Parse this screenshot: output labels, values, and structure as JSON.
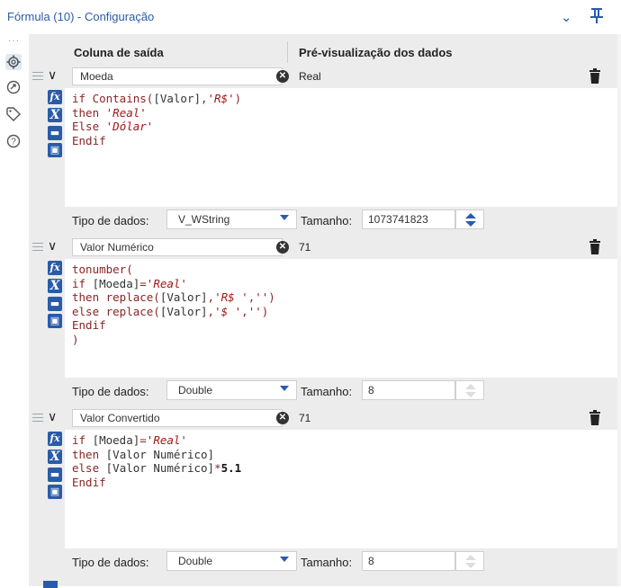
{
  "window": {
    "title": "Fórmula (10) - Configuração"
  },
  "icons": {
    "collapse": "chevron-down-icon",
    "pin": "pin-icon"
  },
  "rail": {
    "dots": "···",
    "items": [
      "settings-icon",
      "navigate-icon",
      "tag-icon",
      "help-icon"
    ]
  },
  "header": {
    "output_column": "Coluna de saída",
    "preview": "Pré-visualização dos dados"
  },
  "formulas": [
    {
      "name": "Moeda",
      "preview": "Real",
      "code_lines": [
        "if Contains([Valor],'R$')",
        "then 'Real'",
        "Else 'Dólar'",
        "Endif"
      ],
      "type_label": "Tipo de dados:",
      "type": "V_WString",
      "size_label": "Tamanho:",
      "size": "1073741823"
    },
    {
      "name": "Valor Numérico",
      "preview": "71",
      "code_lines": [
        "tonumber(",
        "if [Moeda]='Real'",
        "then replace([Valor],'R$ ','')",
        "else replace([Valor],'$ ','')",
        "Endif",
        ")"
      ],
      "type_label": "Tipo de dados:",
      "type": "Double",
      "size_label": "Tamanho:",
      "size": "8"
    },
    {
      "name": "Valor Convertido",
      "preview": "71",
      "code_lines": [
        "if [Moeda]='Real'",
        "then [Valor Numérico]",
        "else [Valor Numérico]*5.1",
        "Endif"
      ],
      "type_label": "Tipo de dados:",
      "type": "Double",
      "size_label": "Tamanho:",
      "size": "8"
    }
  ],
  "colors": {
    "accent": "#2a5ba8",
    "keyword": "#8a2525",
    "string": "#a31515",
    "panel": "#ececec"
  }
}
